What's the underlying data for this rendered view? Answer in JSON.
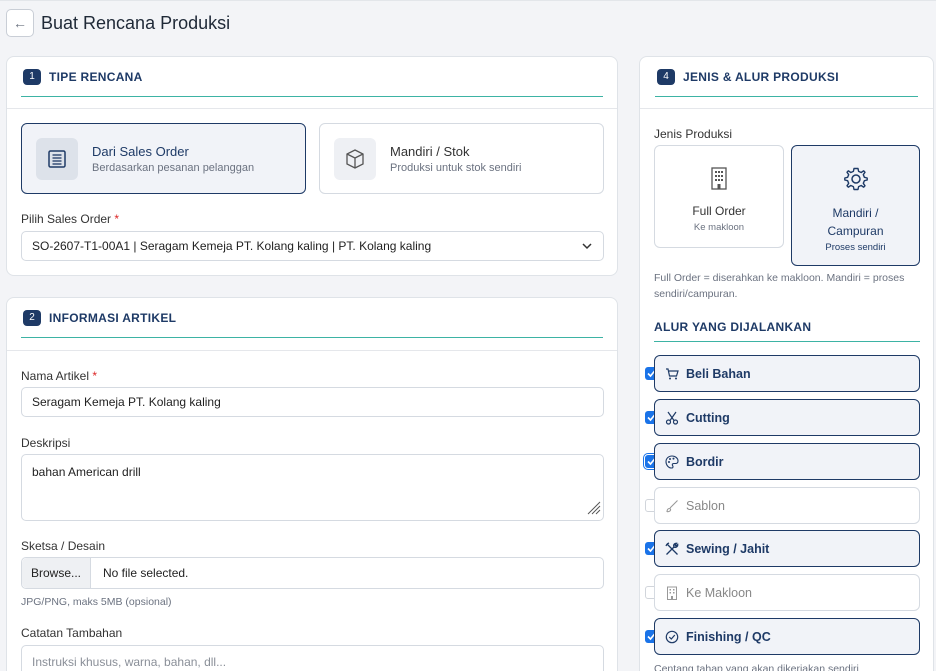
{
  "header": {
    "back_icon": "arrow-left-icon",
    "title": "Buat Rencana Produksi"
  },
  "section1": {
    "number": "1",
    "title": "TIPE RENCANA",
    "options": [
      {
        "title": "Dari Sales Order",
        "subtitle": "Berdasarkan pesanan pelanggan",
        "icon": "list-icon",
        "selected": true
      },
      {
        "title": "Mandiri / Stok",
        "subtitle": "Produksi untuk stok sendiri",
        "icon": "box-icon",
        "selected": false
      }
    ],
    "sales_order_label": "Pilih Sales Order",
    "required_mark": "*",
    "sales_order_value": "SO-2607-T1-00A1 | Seragam Kemeja PT. Kolang kaling | PT. Kolang kaling"
  },
  "section2": {
    "number": "2",
    "title": "INFORMASI ARTIKEL",
    "nama_label": "Nama Artikel",
    "required_mark": "*",
    "nama_value": "Seragam Kemeja PT. Kolang kaling",
    "deskripsi_label": "Deskripsi",
    "deskripsi_value": "bahan American drill",
    "sketsa_label": "Sketsa / Desain",
    "browse_label": "Browse...",
    "file_status": "No file selected.",
    "file_hint": "JPG/PNG, maks 5MB (opsional)",
    "catatan_label": "Catatan Tambahan",
    "catatan_placeholder": "Instruksi khusus, warna, bahan, dll..."
  },
  "section4": {
    "number": "4",
    "title": "JENIS & ALUR PRODUKSI",
    "jenis_label": "Jenis Produksi",
    "jenis_options": [
      {
        "title": "Full Order",
        "subtitle": "Ke makloon",
        "icon": "building-icon",
        "selected": false
      },
      {
        "title": "Mandiri / Campuran",
        "subtitle": "Proses sendiri",
        "icon": "gear-icon",
        "selected": true
      }
    ],
    "jenis_hint": "Full Order = diserahkan ke makloon. Mandiri = proses sendiri/campuran.",
    "alur_title": "ALUR YANG DIJALANKAN",
    "alur_items": [
      {
        "label": "Beli Bahan",
        "icon": "cart-icon",
        "checked": true
      },
      {
        "label": "Cutting",
        "icon": "scissors-icon",
        "checked": true
      },
      {
        "label": "Bordir",
        "icon": "palette-icon",
        "checked": true
      },
      {
        "label": "Sablon",
        "icon": "brush-icon",
        "checked": false
      },
      {
        "label": "Sewing / Jahit",
        "icon": "tools-icon",
        "checked": true
      },
      {
        "label": "Ke Makloon",
        "icon": "building-icon",
        "checked": false
      },
      {
        "label": "Finishing / QC",
        "icon": "check-circle-icon",
        "checked": true
      }
    ],
    "alur_hint": "Centang tahap yang akan dikerjakan sendiri"
  },
  "colors": {
    "accent": "#1e3a66",
    "checkbox": "#1a73e8",
    "divider": "#3db3a4",
    "required": "#dc2626"
  }
}
